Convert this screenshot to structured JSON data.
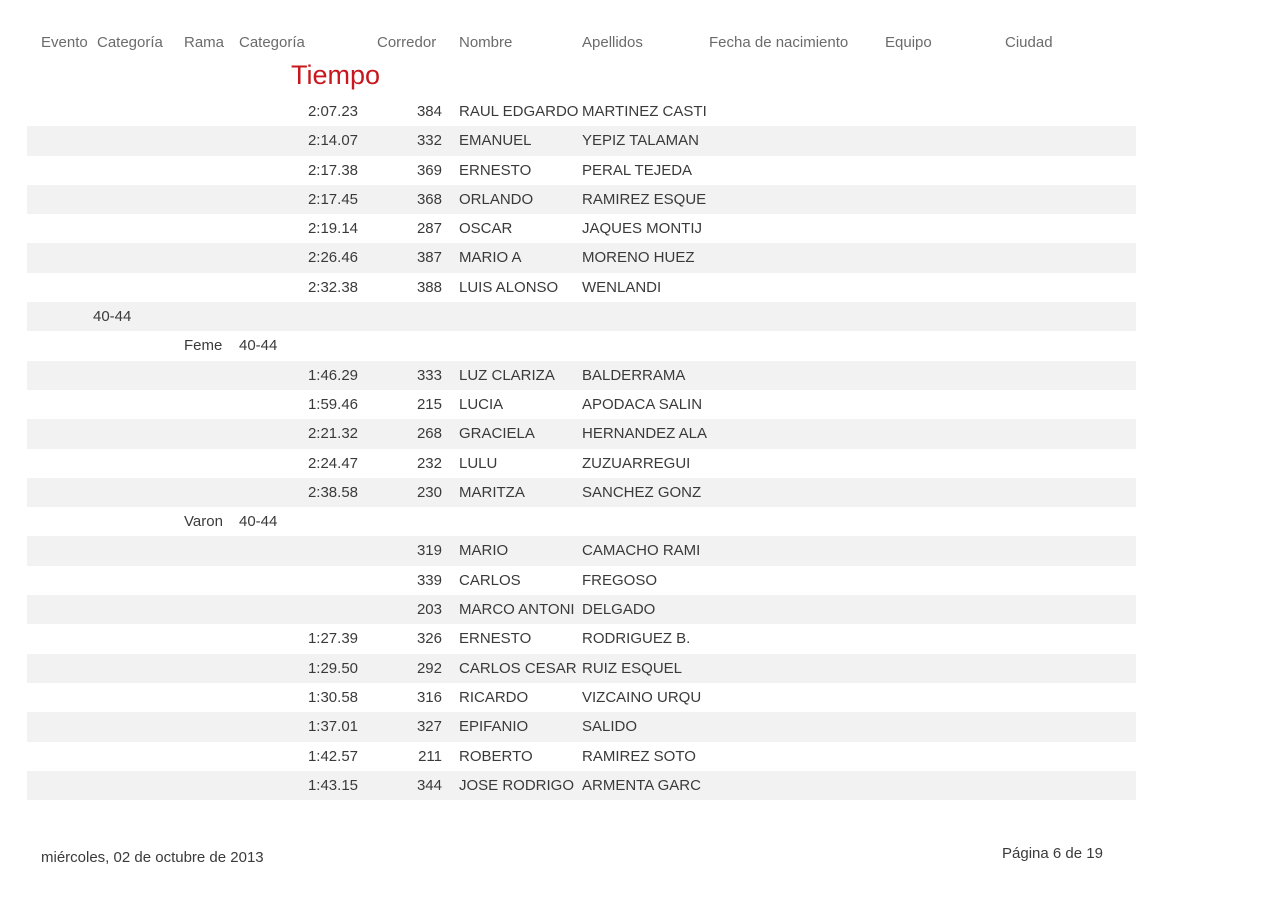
{
  "headers": {
    "evento": "Evento",
    "categoria1": "Categoría",
    "rama": "Rama",
    "categoria2": "Categoría",
    "corredor": "Corredor",
    "nombre": "Nombre",
    "apellidos": "Apellidos",
    "fecha": "Fecha de nacimiento",
    "equipo": "Equipo",
    "ciudad": "Ciudad"
  },
  "tiempo_label": "Tiempo",
  "rows": [
    {
      "cat1": "",
      "rama": "",
      "cat2": "",
      "tiempo": "2:07.23",
      "corredor": "384",
      "nombre": "RAUL EDGARDO",
      "apellidos": "MARTINEZ CASTI"
    },
    {
      "cat1": "",
      "rama": "",
      "cat2": "",
      "tiempo": "2:14.07",
      "corredor": "332",
      "nombre": "EMANUEL",
      "apellidos": "YEPIZ TALAMAN"
    },
    {
      "cat1": "",
      "rama": "",
      "cat2": "",
      "tiempo": "2:17.38",
      "corredor": "369",
      "nombre": "ERNESTO",
      "apellidos": "PERAL TEJEDA"
    },
    {
      "cat1": "",
      "rama": "",
      "cat2": "",
      "tiempo": "2:17.45",
      "corredor": "368",
      "nombre": "ORLANDO",
      "apellidos": "RAMIREZ ESQUE"
    },
    {
      "cat1": "",
      "rama": "",
      "cat2": "",
      "tiempo": "2:19.14",
      "corredor": "287",
      "nombre": "OSCAR",
      "apellidos": "JAQUES MONTIJ"
    },
    {
      "cat1": "",
      "rama": "",
      "cat2": "",
      "tiempo": "2:26.46",
      "corredor": "387",
      "nombre": "MARIO A",
      "apellidos": "MORENO HUEZ"
    },
    {
      "cat1": "",
      "rama": "",
      "cat2": "",
      "tiempo": "2:32.38",
      "corredor": "388",
      "nombre": "LUIS ALONSO",
      "apellidos": "WENLANDI"
    },
    {
      "cat1": "40-44",
      "rama": "",
      "cat2": "",
      "tiempo": "",
      "corredor": "",
      "nombre": "",
      "apellidos": ""
    },
    {
      "cat1": "",
      "rama": "Feme",
      "cat2": "40-44",
      "tiempo": "",
      "corredor": "",
      "nombre": "",
      "apellidos": ""
    },
    {
      "cat1": "",
      "rama": "",
      "cat2": "",
      "tiempo": "1:46.29",
      "corredor": "333",
      "nombre": "LUZ CLARIZA",
      "apellidos": "BALDERRAMA"
    },
    {
      "cat1": "",
      "rama": "",
      "cat2": "",
      "tiempo": "1:59.46",
      "corredor": "215",
      "nombre": "LUCIA",
      "apellidos": "APODACA SALIN"
    },
    {
      "cat1": "",
      "rama": "",
      "cat2": "",
      "tiempo": "2:21.32",
      "corredor": "268",
      "nombre": "GRACIELA",
      "apellidos": "HERNANDEZ ALA"
    },
    {
      "cat1": "",
      "rama": "",
      "cat2": "",
      "tiempo": "2:24.47",
      "corredor": "232",
      "nombre": "LULU",
      "apellidos": "ZUZUARREGUI"
    },
    {
      "cat1": "",
      "rama": "",
      "cat2": "",
      "tiempo": "2:38.58",
      "corredor": "230",
      "nombre": "MARITZA",
      "apellidos": "SANCHEZ GONZ"
    },
    {
      "cat1": "",
      "rama": "Varon",
      "cat2": "40-44",
      "tiempo": "",
      "corredor": "",
      "nombre": "",
      "apellidos": ""
    },
    {
      "cat1": "",
      "rama": "",
      "cat2": "",
      "tiempo": "",
      "corredor": "319",
      "nombre": "MARIO",
      "apellidos": "CAMACHO RAMI"
    },
    {
      "cat1": "",
      "rama": "",
      "cat2": "",
      "tiempo": "",
      "corredor": "339",
      "nombre": "CARLOS",
      "apellidos": "FREGOSO"
    },
    {
      "cat1": "",
      "rama": "",
      "cat2": "",
      "tiempo": "",
      "corredor": "203",
      "nombre": "MARCO ANTONI",
      "apellidos": "DELGADO"
    },
    {
      "cat1": "",
      "rama": "",
      "cat2": "",
      "tiempo": "1:27.39",
      "corredor": "326",
      "nombre": "ERNESTO",
      "apellidos": "RODRIGUEZ B."
    },
    {
      "cat1": "",
      "rama": "",
      "cat2": "",
      "tiempo": "1:29.50",
      "corredor": "292",
      "nombre": "CARLOS CESAR",
      "apellidos": "RUIZ ESQUEL"
    },
    {
      "cat1": "",
      "rama": "",
      "cat2": "",
      "tiempo": "1:30.58",
      "corredor": "316",
      "nombre": "RICARDO",
      "apellidos": "VIZCAINO URQU"
    },
    {
      "cat1": "",
      "rama": "",
      "cat2": "",
      "tiempo": "1:37.01",
      "corredor": "327",
      "nombre": "EPIFANIO",
      "apellidos": "SALIDO"
    },
    {
      "cat1": "",
      "rama": "",
      "cat2": "",
      "tiempo": "1:42.57",
      "corredor": "211",
      "nombre": "ROBERTO",
      "apellidos": "RAMIREZ SOTO"
    },
    {
      "cat1": "",
      "rama": "",
      "cat2": "",
      "tiempo": "1:43.15",
      "corredor": "344",
      "nombre": "JOSE RODRIGO",
      "apellidos": "ARMENTA GARC"
    }
  ],
  "footer": {
    "date": "miércoles, 02 de octubre de 2013",
    "page": "Página 6 de 19"
  }
}
